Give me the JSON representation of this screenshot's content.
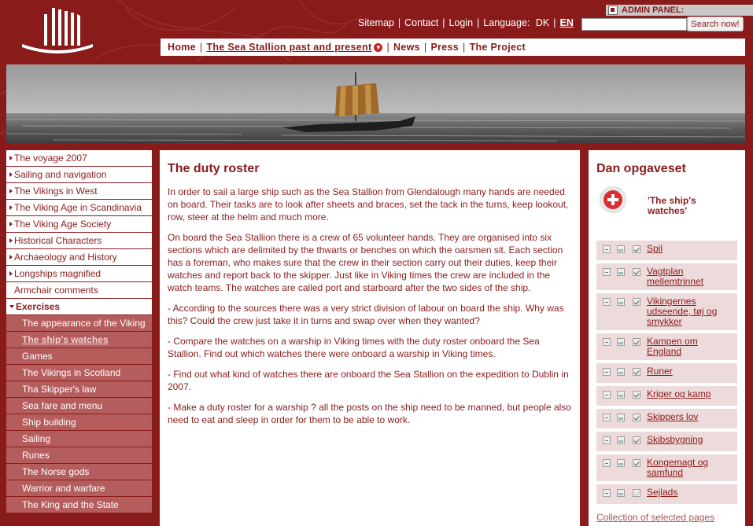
{
  "header": {
    "links": [
      "Sitemap",
      "Contact",
      "Login"
    ],
    "language_label": "Language:",
    "lang_dk": "DK",
    "lang_en": "EN",
    "search_placeholder": "",
    "search_button": "Search now!",
    "admin_panel": "ADMIN PANEL:"
  },
  "mainnav": {
    "home": "Home",
    "past_present": "The Sea Stallion past and present",
    "news": "News",
    "press": "Press",
    "project": "The Project"
  },
  "sidebar": {
    "items": [
      "The voyage 2007",
      "Sailing and navigation",
      "The Vikings in West",
      "The Viking Age in Scandinavia",
      "The Viking Age Society",
      "Historical Characters",
      "Archaeology and History",
      "Longships magnified",
      "Armchair comments",
      "Exercises"
    ],
    "subitems": [
      "The appearance of the Viking",
      "The ship's watches",
      "Games",
      "The Vikings in Scotland",
      "Tha Skipper's law",
      "Sea fare and menu",
      "Ship building",
      "Sailing",
      "Runes",
      "The Norse gods",
      "Warrior and warfare",
      "The King and the State"
    ]
  },
  "content": {
    "title": "The duty roster",
    "paragraphs": [
      "In order to sail a large ship such as the Sea Stallion from Glendalough many hands are needed on board. Their tasks are to look after sheets and braces, set the tack in the turns, keep lookout, row, steer at the helm and much more.",
      "On board the Sea Stallion there is a crew of 65 volunteer hands. They are organised into six sections which are delimited by the thwarts or benches on which the oarsmen sit. Each section has a foreman, who makes sure that the crew in their section carry out their duties, keep their watches and report back to the skipper. Just like in Viking times the crew are included in the watch teams. The watches are called port and starboard after the two sides of the ship.",
      "- According to the sources there was a very strict division of labour on board the ship. Why was this? Could the crew just take it in turns and swap over when they wanted?",
      "- Compare the watches on a warship in Viking times with the duty roster onboard the Sea Stallion. Find out which watches there were onboard a warship in Viking times.",
      "- Find out what kind of watches there are onboard the Sea Stallion on the expedition to Dublin in 2007.",
      "- Make a duty roster for a warship ? all the posts on the ship need to be manned, but people also need to eat and sleep in order for them to be able to work."
    ]
  },
  "right": {
    "title": "Dan opgaveset",
    "featured": "'The ship's watches'",
    "items": [
      "Spil",
      "Vagtplan mellemtrinnet",
      "Vikingernes udseende, tøj og smykker",
      "Kampen om England",
      "Runer",
      "Kriger og kamp",
      "Skippers lov",
      "Skibsbygning",
      "Kongemagt og samfund",
      "Sejlads"
    ],
    "collection_link": "Collection of selected pages"
  }
}
